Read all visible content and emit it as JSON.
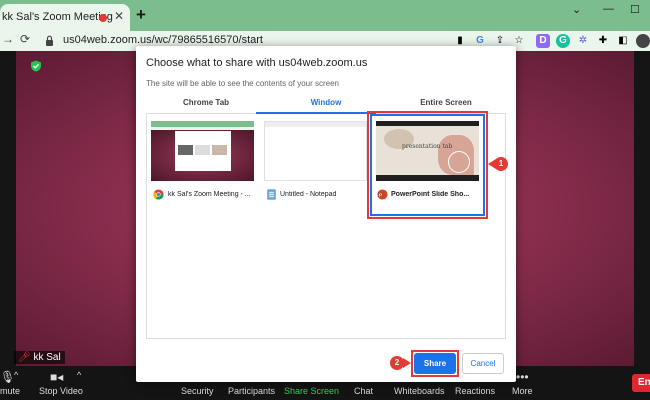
{
  "browser": {
    "tab_title": "kk Sal's Zoom Meeting",
    "tab_close": "✕",
    "new_tab": "+",
    "minimize": "⌄",
    "restore": "—",
    "maximize": "☐",
    "url": "us04web.zoom.us/wc/79865516570/start",
    "toolbar_icons": [
      "camera-icon",
      "google-icon",
      "share-icon",
      "star-icon",
      "extension-d-icon",
      "grammarly-icon",
      "gear-extension-icon",
      "puzzle-icon",
      "sidebar-icon",
      "profile-icon"
    ]
  },
  "dialog": {
    "title": "Choose what to share with us04web.zoom.us",
    "subtitle": "The site will be able to see the contents of your screen",
    "tabs": [
      "Chrome Tab",
      "Window",
      "Entire Screen"
    ],
    "active_tab": "Window",
    "windows": [
      {
        "label": "kk Sal's Zoom Meeting - ...",
        "icon": "chrome-icon"
      },
      {
        "label": "Untitled - Notepad",
        "icon": "notepad-icon"
      },
      {
        "label": "PowerPoint Slide Sho...",
        "icon": "powerpoint-icon",
        "selected": true
      }
    ],
    "slide_text": "presentation tab",
    "share_label": "Share",
    "cancel_label": "Cancel"
  },
  "annotations": {
    "step1": "1",
    "step2": "2"
  },
  "meeting": {
    "participant_name": "kk Sal",
    "toolbar": {
      "mute": "mute",
      "stop_video": "Stop Video",
      "security": "Security",
      "participants": "Participants",
      "share_screen": "Share Screen",
      "chat": "Chat",
      "whiteboards": "Whiteboards",
      "reactions": "Reactions",
      "more": "More",
      "end": "En"
    }
  },
  "colors": {
    "accent": "#1a73e8",
    "annotation": "#e53935",
    "browser_green": "#7bbd8c"
  }
}
